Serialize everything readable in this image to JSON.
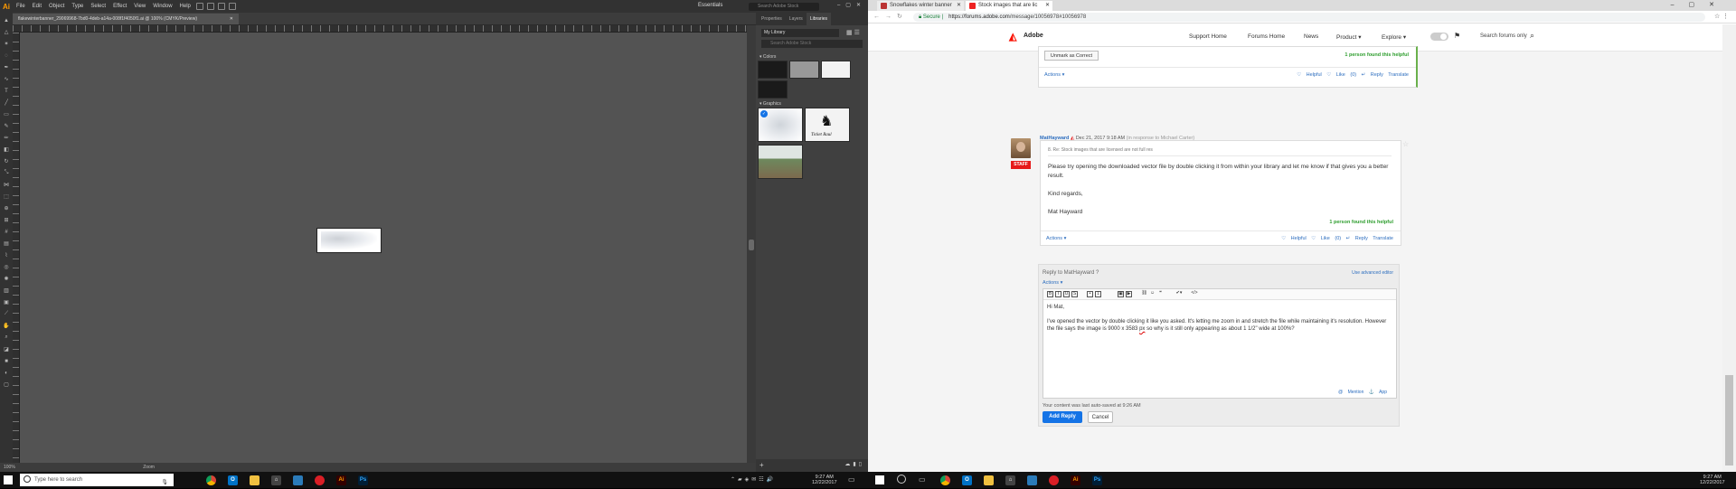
{
  "illustrator": {
    "logo": "Ai",
    "menus": [
      "File",
      "Edit",
      "Object",
      "Type",
      "Select",
      "Effect",
      "View",
      "Window",
      "Help"
    ],
    "workspace": "Essentials",
    "search_placeholder": "Search Adobe Stock",
    "document_tab": "flakewinterbanner_29069968-7bd0-4deb-a14a-008f1f4050f1.ai @ 100% (CMYK/Preview)",
    "zoom_status": "100%",
    "status_tool": "Zoom",
    "panel_tabs": [
      "Properties",
      "Layers",
      "Libraries"
    ],
    "active_panel_tab": "Libraries",
    "library_name": "My Library",
    "library_search_placeholder": "Search Adobe Stock",
    "colors_label": "Colors",
    "graphics_label": "Graphics",
    "swatches": [
      "#1a1a1a",
      "#999999",
      "#f2f2f2",
      "#1a1a1a"
    ],
    "graphic_logo_text": "Ticket Raul"
  },
  "browser": {
    "tabs": [
      {
        "title": "Snowflakes winter banner",
        "active": false
      },
      {
        "title": "Stock images that are lic",
        "active": true
      }
    ],
    "secure_label": "Secure",
    "url_host": "https://forums.adobe.com",
    "url_path": "/message/10056978#10056978",
    "site": {
      "brand": "Adobe",
      "nav": [
        "Support Home",
        "Forums Home",
        "News",
        "Product ▾",
        "Explore ▾"
      ],
      "search_placeholder": "Search forums only"
    },
    "post1": {
      "unmark_label": "Unmark as Correct",
      "helpful_text": "1 person found this helpful",
      "actions_label": "Actions ▾",
      "links": "♡ Helpful  ♡ Like (0)  ↵ Reply  Translate"
    },
    "post2": {
      "author": "MatHayward",
      "date": "Dec 21, 2017 9:18 AM",
      "in_response": "(in response to Michael Carter)",
      "staff_badge": "STAFF",
      "re_line": "8. Re: Stock images that are licensed are not full res",
      "body_1": "Please try opening the downloaded vector file by double clicking it from within your library and let me know if that gives you a better result.",
      "body_2": "Kind regards,",
      "body_3": "Mat Hayward",
      "helpful_text": "1 person found this helpful",
      "actions_label": "Actions ▾",
      "links": "♡ Helpful  ♡ Like (0)  ↵ Reply  Translate"
    },
    "reply": {
      "title": "Reply to MatHayward",
      "advanced_editor": "Use advanced editor",
      "actions_label": "Actions ▾",
      "text_greeting": "Hi Mat,",
      "text_body_a": "I've opened the vector by double clicking it like you asked. It's letting me zoom in and stretch the file while maintaining it's resolution. However the file says the image is 9000 x 3583 ",
      "text_spell": "px",
      "text_body_b": " so why is it still only appearing as about 1 1/2\" wide at 100%?",
      "mention_links": "@ Mention  ⚓ App",
      "autosave": "Your content was last auto-saved at 9:26 AM",
      "add_reply_label": "Add Reply",
      "cancel_label": "Cancel"
    }
  },
  "taskbar": {
    "search_placeholder": "Type here to search",
    "time_left": "9:27 AM",
    "date_left": "12/22/2017",
    "time_right": "9:27 AM",
    "date_right": "12/22/2017"
  }
}
